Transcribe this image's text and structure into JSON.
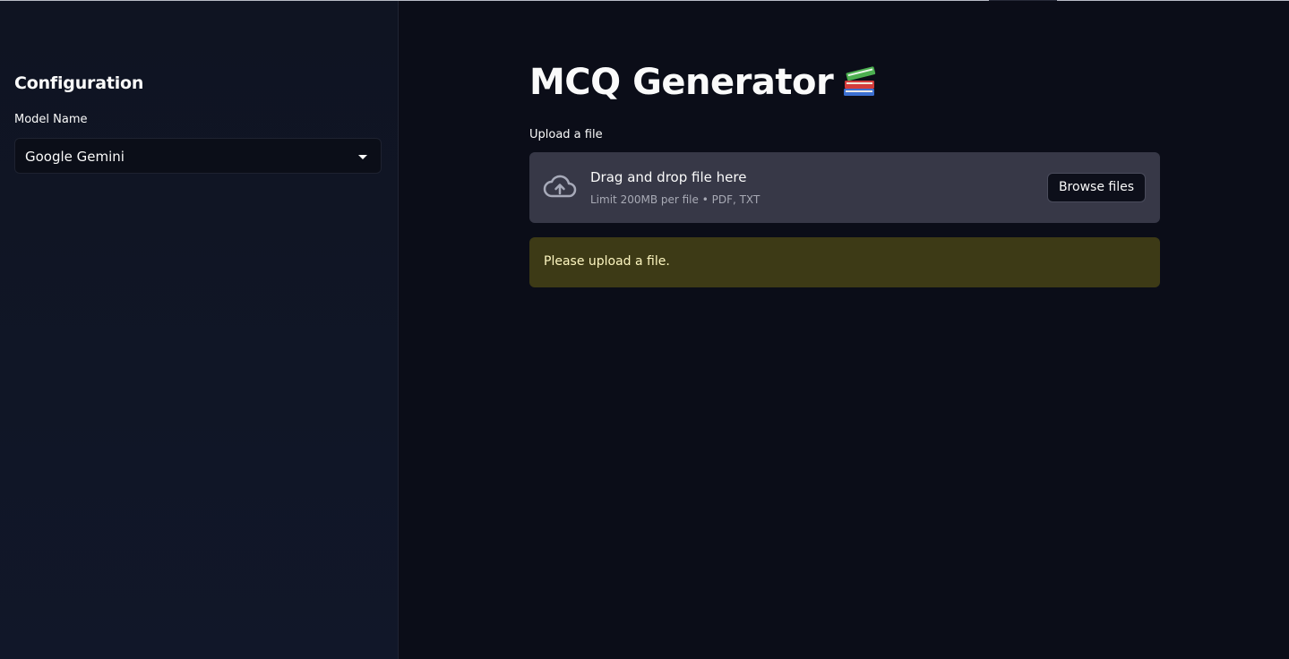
{
  "sidebar": {
    "title": "Configuration",
    "model_field": {
      "label": "Model Name",
      "selected": "Google Gemini"
    }
  },
  "main": {
    "title": "MCQ Generator",
    "title_emoji": "books-icon",
    "uploader": {
      "label": "Upload a file",
      "drop_text": "Drag and drop file here",
      "limit_text": "Limit 200MB per file • PDF, TXT",
      "browse_label": "Browse files",
      "icon": "cloud-upload-icon"
    },
    "warning": {
      "text": "Please upload a file."
    }
  },
  "colors": {
    "background": "#0b0d18",
    "sidebar": "#0f1422",
    "dropzone": "#373847",
    "warning_bg": "#3d3a16",
    "warning_text": "#fdf6c0"
  }
}
